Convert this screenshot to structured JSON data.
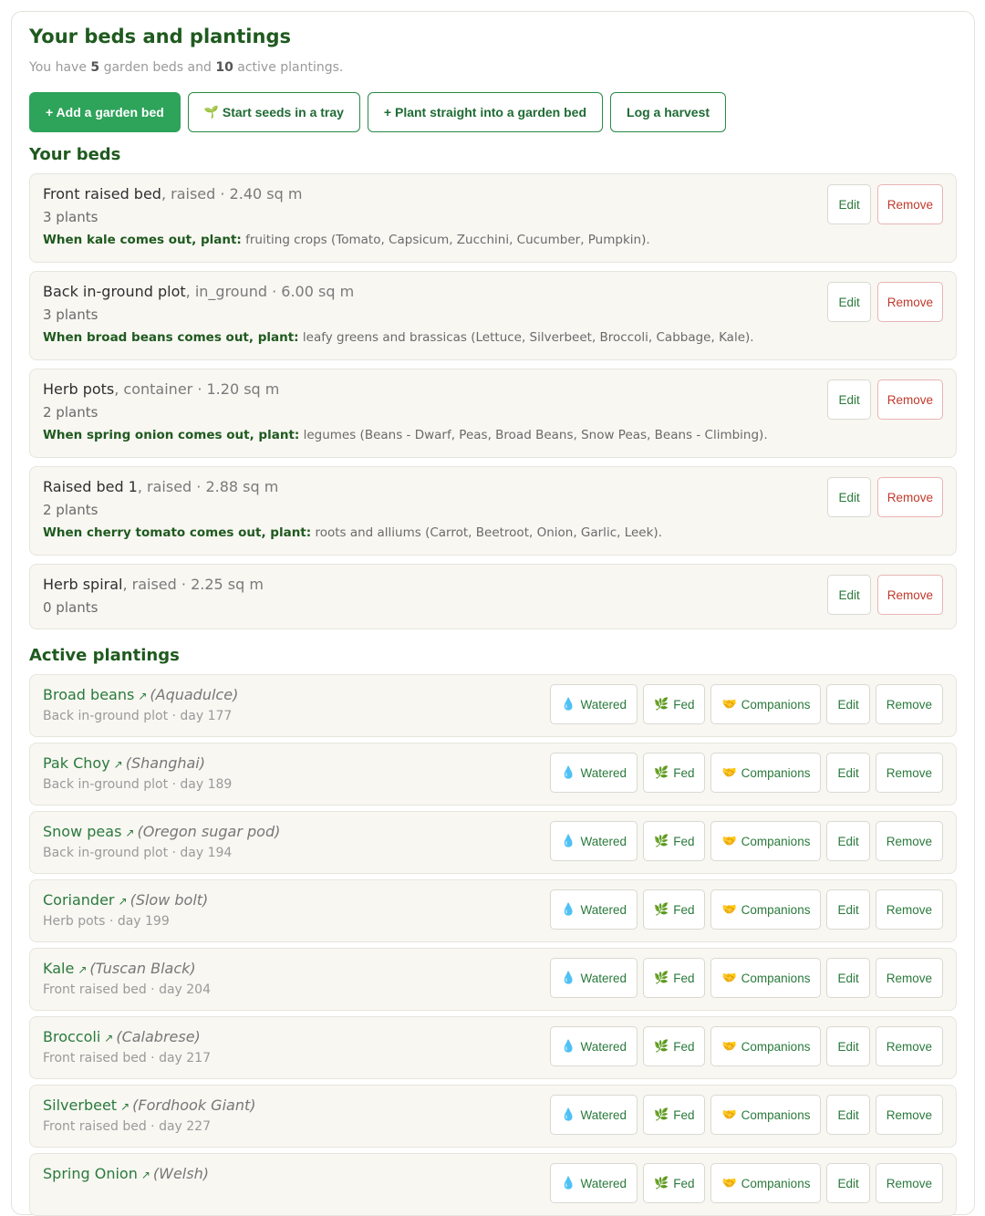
{
  "header": {
    "title": "Your beds and plantings",
    "summary_prefix": "You have",
    "bed_count": "5",
    "summary_mid": "garden beds and",
    "planting_count": "10",
    "summary_suffix": "active plantings."
  },
  "actions": {
    "add_bed": "+ Add a garden bed",
    "start_seeds": "Start seeds in a tray",
    "plant_direct": "+ Plant straight into a garden bed",
    "log_harvest": "Log a harvest"
  },
  "beds_section": {
    "title": "Your beds"
  },
  "beds": [
    {
      "name": "Front raised bed",
      "meta": ", raised · 2.40 sq m",
      "plants": "3 plants",
      "rotation_label": "When kale comes out, plant:",
      "rotation_text": "fruiting crops (Tomato, Capsicum, Zucchini, Cucumber, Pumpkin)."
    },
    {
      "name": "Back in-ground plot",
      "meta": ", in_ground · 6.00 sq m",
      "plants": "3 plants",
      "rotation_label": "When broad beans comes out, plant:",
      "rotation_text": "leafy greens and brassicas (Lettuce, Silverbeet, Broccoli, Cabbage, Kale)."
    },
    {
      "name": "Herb pots",
      "meta": ", container · 1.20 sq m",
      "plants": "2 plants",
      "rotation_label": "When spring onion comes out, plant:",
      "rotation_text": "legumes (Beans - Dwarf, Peas, Broad Beans, Snow Peas, Beans - Climbing)."
    },
    {
      "name": "Raised bed 1",
      "meta": ", raised · 2.88 sq m",
      "plants": "2 plants",
      "rotation_label": "When cherry tomato comes out, plant:",
      "rotation_text": "roots and alliums (Carrot, Beetroot, Onion, Garlic, Leek)."
    },
    {
      "name": "Herb spiral",
      "meta": ", raised · 2.25 sq m",
      "plants": "0 plants"
    }
  ],
  "bed_buttons": {
    "edit": "Edit",
    "remove": "Remove"
  },
  "plantings_section": {
    "title": "Active plantings"
  },
  "plantings": [
    {
      "name": "Broad beans",
      "variety": "(Aquadulce)",
      "meta": "Back in-ground plot · day 177"
    },
    {
      "name": "Pak Choy",
      "variety": "(Shanghai)",
      "meta": "Back in-ground plot · day 189"
    },
    {
      "name": "Snow peas",
      "variety": "(Oregon sugar pod)",
      "meta": "Back in-ground plot · day 194"
    },
    {
      "name": "Coriander",
      "variety": "(Slow bolt)",
      "meta": "Herb pots · day 199"
    },
    {
      "name": "Kale",
      "variety": "(Tuscan Black)",
      "meta": "Front raised bed · day 204"
    },
    {
      "name": "Broccoli",
      "variety": "(Calabrese)",
      "meta": "Front raised bed · day 217"
    },
    {
      "name": "Silverbeet",
      "variety": "(Fordhook Giant)",
      "meta": "Front raised bed · day 227"
    },
    {
      "name": "Spring Onion",
      "variety": "(Welsh)",
      "meta": ""
    }
  ],
  "planting_buttons": {
    "watered": "Watered",
    "fed": "Fed",
    "companions": "Companions",
    "edit": "Edit",
    "remove": "Remove"
  },
  "icons": {
    "arrow": "↗",
    "seedling": "🌱",
    "drop": "💧",
    "leaf": "🌿",
    "handshake": "🤝"
  }
}
